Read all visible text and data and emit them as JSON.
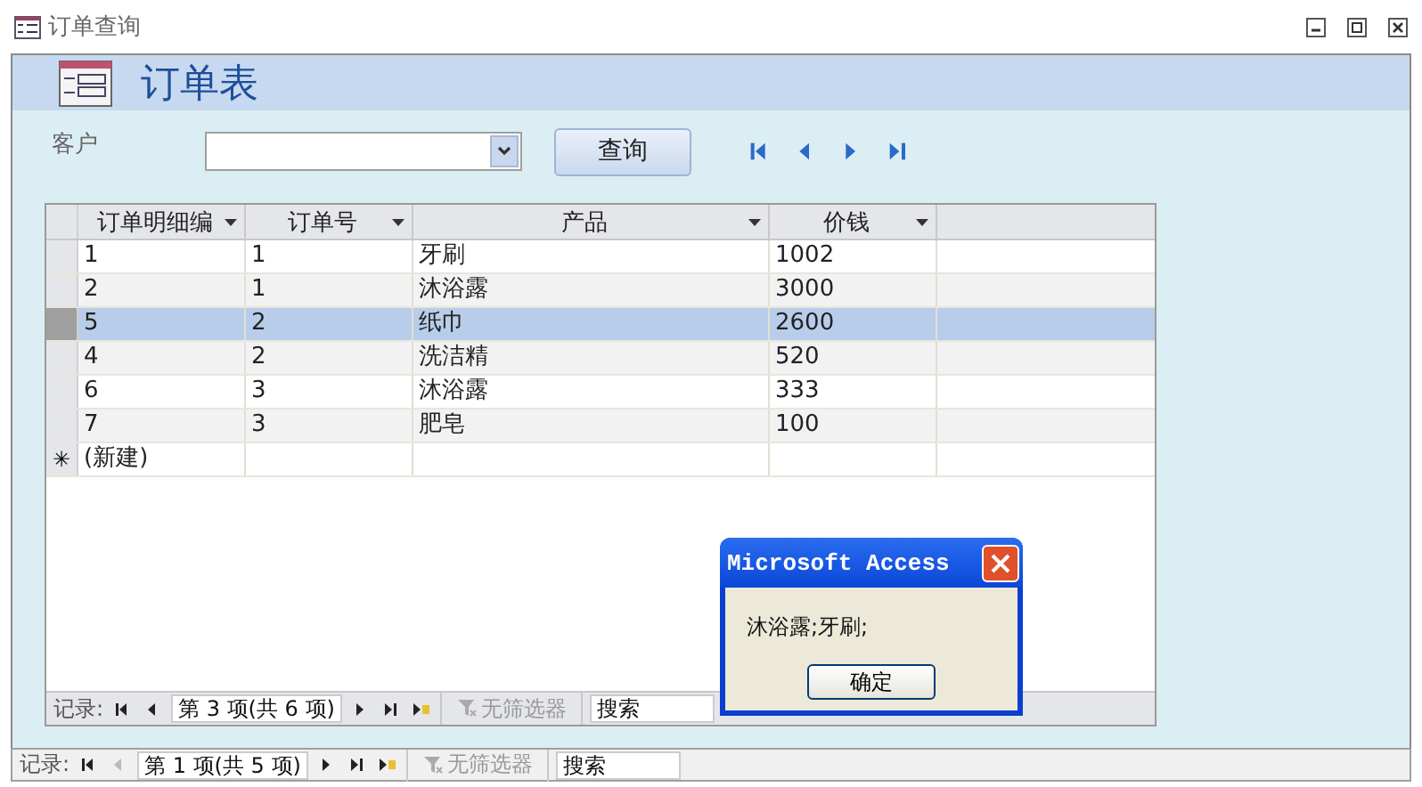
{
  "window": {
    "title": "订单查询"
  },
  "form": {
    "title": "订单表"
  },
  "filter": {
    "label": "客户",
    "query_button": "查询"
  },
  "record_buttons": [
    {
      "kind": "first"
    },
    {
      "kind": "prev"
    },
    {
      "kind": "next"
    },
    {
      "kind": "last"
    }
  ],
  "table": {
    "columns": [
      "订单明细编",
      "订单号",
      "产品",
      "价钱"
    ],
    "rows": [
      {
        "cells": [
          "1",
          "1",
          "牙刷",
          "1002"
        ],
        "selected": false
      },
      {
        "cells": [
          "2",
          "1",
          "沐浴露",
          "3000"
        ],
        "selected": false
      },
      {
        "cells": [
          "5",
          "2",
          "纸巾",
          "2600"
        ],
        "selected": true
      },
      {
        "cells": [
          "4",
          "2",
          "洗洁精",
          "520"
        ],
        "selected": false
      },
      {
        "cells": [
          "6",
          "3",
          "沐浴露",
          "333"
        ],
        "selected": false
      },
      {
        "cells": [
          "7",
          "3",
          "肥皂",
          "100"
        ],
        "selected": false
      }
    ],
    "new_row": {
      "marker": "✳",
      "label": "(新建)"
    },
    "navigator": {
      "label": "记录:",
      "position": "第 3 项(共 6 项)",
      "buttons": [
        {
          "kind": "first",
          "disabled": false
        },
        {
          "kind": "prev",
          "disabled": false
        },
        {
          "kind": "next",
          "disabled": false
        },
        {
          "kind": "last",
          "disabled": false
        },
        {
          "kind": "new",
          "disabled": false
        }
      ],
      "filter": "无筛选器",
      "placeholder": "搜索"
    }
  },
  "form_navigator": {
    "label": "记录:",
    "position": "第 1 项(共 5 项)",
    "buttons": [
      {
        "kind": "first",
        "disabled": false
      },
      {
        "kind": "prev",
        "disabled": true
      },
      {
        "kind": "next",
        "disabled": false
      },
      {
        "kind": "last",
        "disabled": false
      },
      {
        "kind": "new",
        "disabled": false
      }
    ],
    "filter": "无筛选器",
    "placeholder": "搜索"
  },
  "dialog": {
    "title": "Microsoft Access",
    "message": "沐浴露;牙刷;",
    "button": "确定"
  }
}
